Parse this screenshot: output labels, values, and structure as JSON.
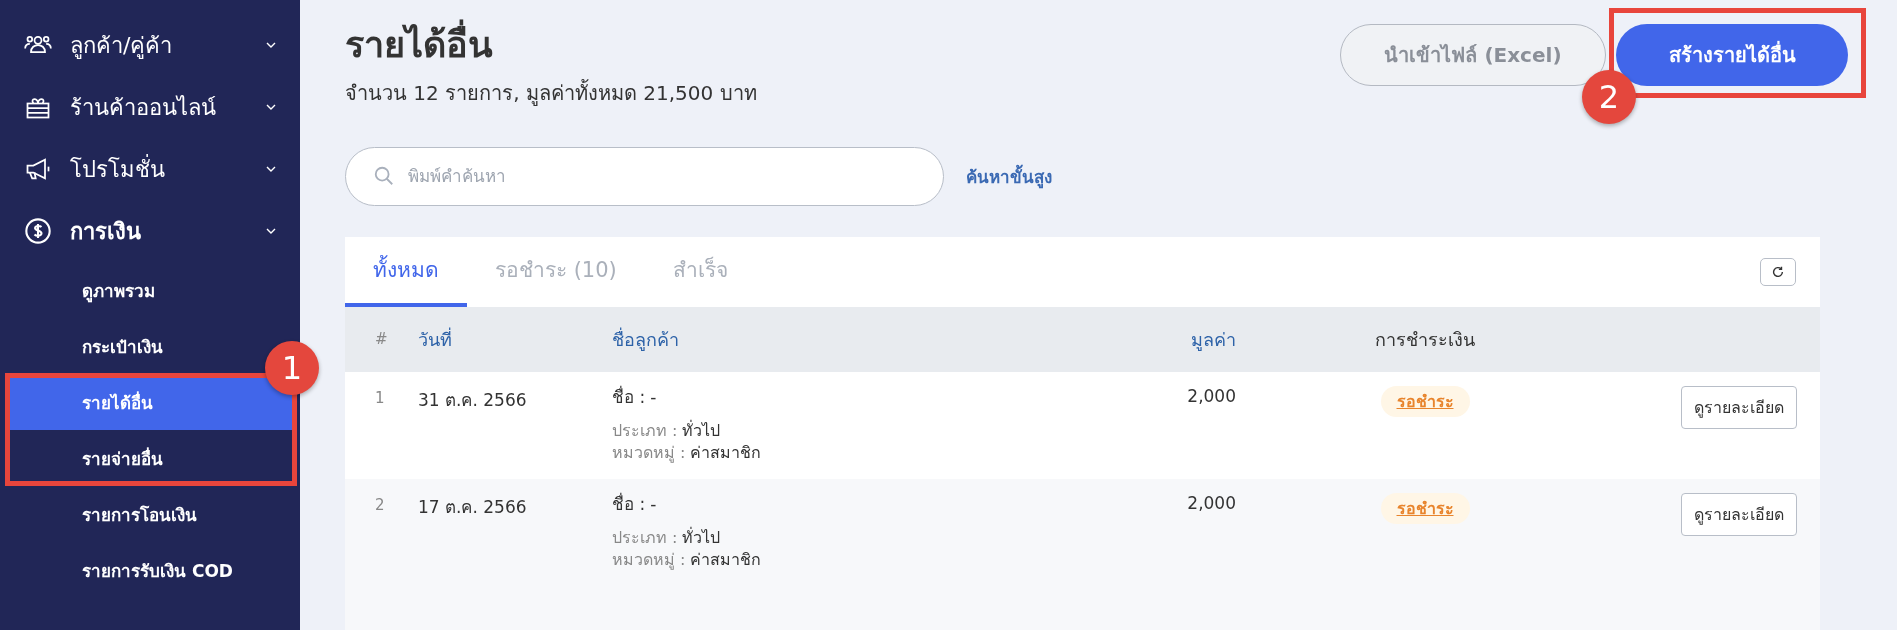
{
  "sidebar": {
    "items": [
      {
        "label": "ลูกค้า/คู่ค้า",
        "expanded": false
      },
      {
        "label": "ร้านค้าออนไลน์",
        "expanded": false
      },
      {
        "label": "โปรโมชั่น",
        "expanded": false
      },
      {
        "label": "การเงิน",
        "expanded": true,
        "children": [
          {
            "label": "ดูภาพรวม",
            "selected": false
          },
          {
            "label": "กระเป๋าเงิน",
            "selected": false
          },
          {
            "label": "รายได้อื่น",
            "selected": true
          },
          {
            "label": "รายจ่ายอื่น",
            "selected": false
          },
          {
            "label": "รายการโอนเงิน",
            "selected": false
          },
          {
            "label": "รายการรับเงิน COD",
            "selected": false
          }
        ]
      }
    ]
  },
  "header": {
    "title": "รายได้อื่น",
    "summary": "จำนวน 12 รายการ, มูลค่าทั้งหมด 21,500 บาท",
    "buttons": [
      {
        "label": "นำเข้าไฟล์ (Excel)",
        "kind": "secondary"
      },
      {
        "label": "สร้างรายได้อื่น",
        "kind": "primary"
      }
    ]
  },
  "search": {
    "placeholder": "พิมพ์คำค้นหา",
    "advanced_link": "ค้นหาขั้นสูง"
  },
  "tabs": [
    {
      "label": "ทั้งหมด",
      "selected": true
    },
    {
      "label": "รอชำระ (10)",
      "selected": false
    },
    {
      "label": "สำเร็จ",
      "selected": false
    }
  ],
  "table": {
    "columns": [
      "#",
      "วันที่",
      "ชื่อลูกค้า",
      "มูลค่า",
      "การชำระเงิน"
    ],
    "rows": [
      {
        "number": "1",
        "date": "31 ต.ค. 2566",
        "name_label": "ชื่อ :",
        "name": "-",
        "type_label": "ประเภท :",
        "type": "ทั่วไป",
        "category_label": "หมวดหมู่ :",
        "category": "ค่าสมาชิก",
        "amount": "2,000",
        "status": "รอชำระ",
        "action": "ดูรายละเอียด"
      },
      {
        "number": "2",
        "date": "17 ต.ค. 2566",
        "name_label": "ชื่อ :",
        "name": "-",
        "type_label": "ประเภท :",
        "type": "ทั่วไป",
        "category_label": "หมวดหมู่ :",
        "category": "ค่าสมาชิก",
        "amount": "2,000",
        "status": "รอชำระ",
        "action": "ดูรายละเอียด"
      }
    ]
  },
  "annotations": [
    {
      "number": "1"
    },
    {
      "number": "2"
    }
  ]
}
